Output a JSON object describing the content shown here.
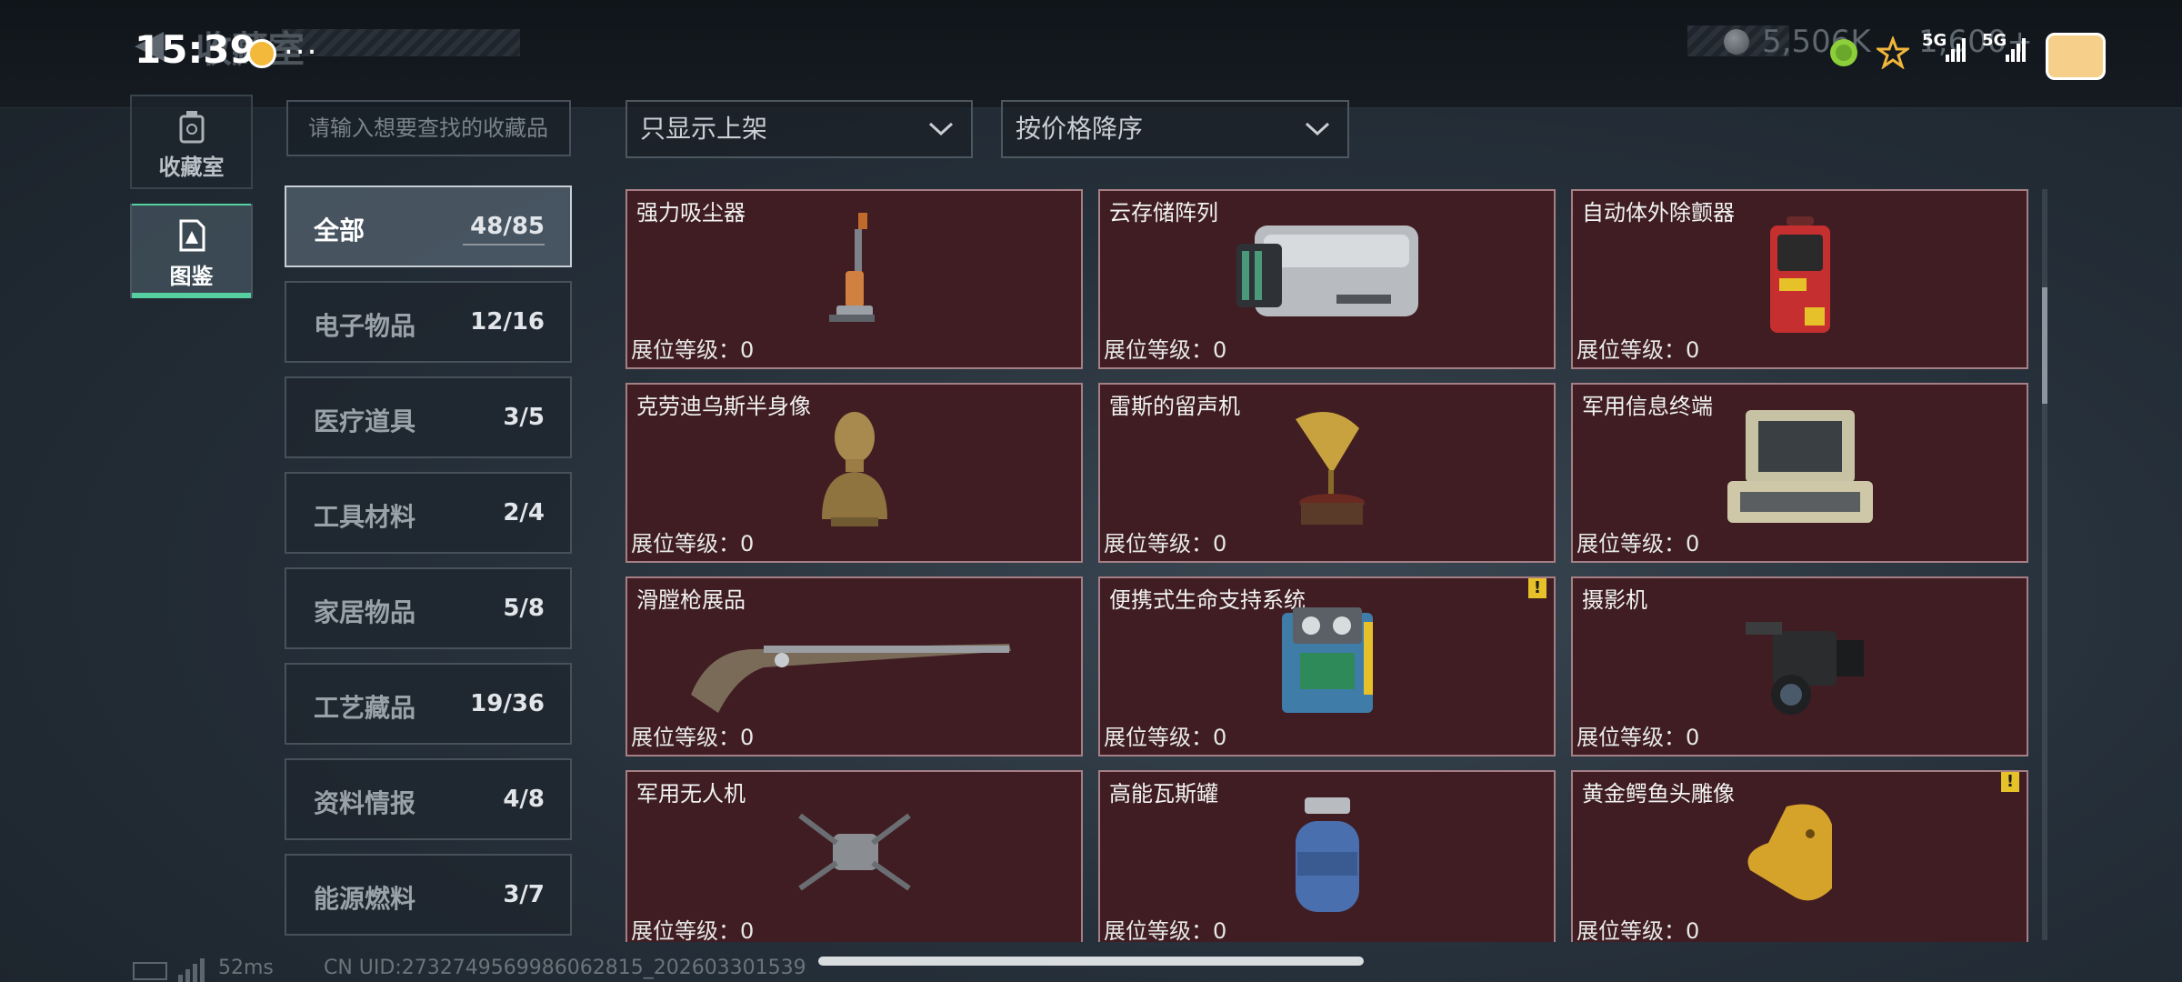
{
  "status_bar": {
    "time": "15:39",
    "title": "收藏室",
    "more": "...",
    "currency_1": "5,506K",
    "currency_2": "1,600+",
    "network_1": "5G",
    "network_2": "5G"
  },
  "nav": {
    "items": [
      {
        "label": "收藏室",
        "icon": "trash-icon",
        "active": false
      },
      {
        "label": "图鉴",
        "icon": "catalog-icon",
        "active": true
      }
    ]
  },
  "search": {
    "placeholder": "请输入想要查找的收藏品"
  },
  "filters": {
    "listing": "只显示上架",
    "sort": "按价格降序"
  },
  "categories": [
    {
      "name": "全部",
      "count": "48/85",
      "active": true
    },
    {
      "name": "电子物品",
      "count": "12/16"
    },
    {
      "name": "医疗道具",
      "count": "3/5"
    },
    {
      "name": "工具材料",
      "count": "2/4"
    },
    {
      "name": "家居物品",
      "count": "5/8"
    },
    {
      "name": "工艺藏品",
      "count": "19/36"
    },
    {
      "name": "资料情报",
      "count": "4/8"
    },
    {
      "name": "能源燃料",
      "count": "3/7"
    }
  ],
  "level_label": "展位等级：",
  "items": [
    {
      "name": "强力吸尘器",
      "level": "0",
      "icon": "vacuum-cleaner-icon",
      "warning": false
    },
    {
      "name": "云存储阵列",
      "level": "0",
      "icon": "storage-array-icon",
      "warning": false
    },
    {
      "name": "自动体外除颤器",
      "level": "0",
      "icon": "defibrillator-icon",
      "warning": false
    },
    {
      "name": "克劳迪乌斯半身像",
      "level": "0",
      "icon": "bust-statue-icon",
      "warning": false
    },
    {
      "name": "雷斯的留声机",
      "level": "0",
      "icon": "gramophone-icon",
      "warning": false
    },
    {
      "name": "军用信息终端",
      "level": "0",
      "icon": "military-terminal-icon",
      "warning": false
    },
    {
      "name": "滑膛枪展品",
      "level": "0",
      "icon": "musket-icon",
      "warning": false
    },
    {
      "name": "便携式生命支持系统",
      "level": "0",
      "icon": "life-support-icon",
      "warning": true
    },
    {
      "name": "摄影机",
      "level": "0",
      "icon": "camera-icon",
      "warning": false
    },
    {
      "name": "军用无人机",
      "level": "0",
      "icon": "drone-icon",
      "warning": false
    },
    {
      "name": "高能瓦斯罐",
      "level": "0",
      "icon": "gas-tank-icon",
      "warning": false
    },
    {
      "name": "黄金鳄鱼头雕像",
      "level": "0",
      "icon": "gold-crocodile-icon",
      "warning": true
    }
  ],
  "warning_glyph": "!",
  "footer": {
    "ping": "52ms",
    "uid": "CN UID:2732749569986062815_202603301539"
  }
}
